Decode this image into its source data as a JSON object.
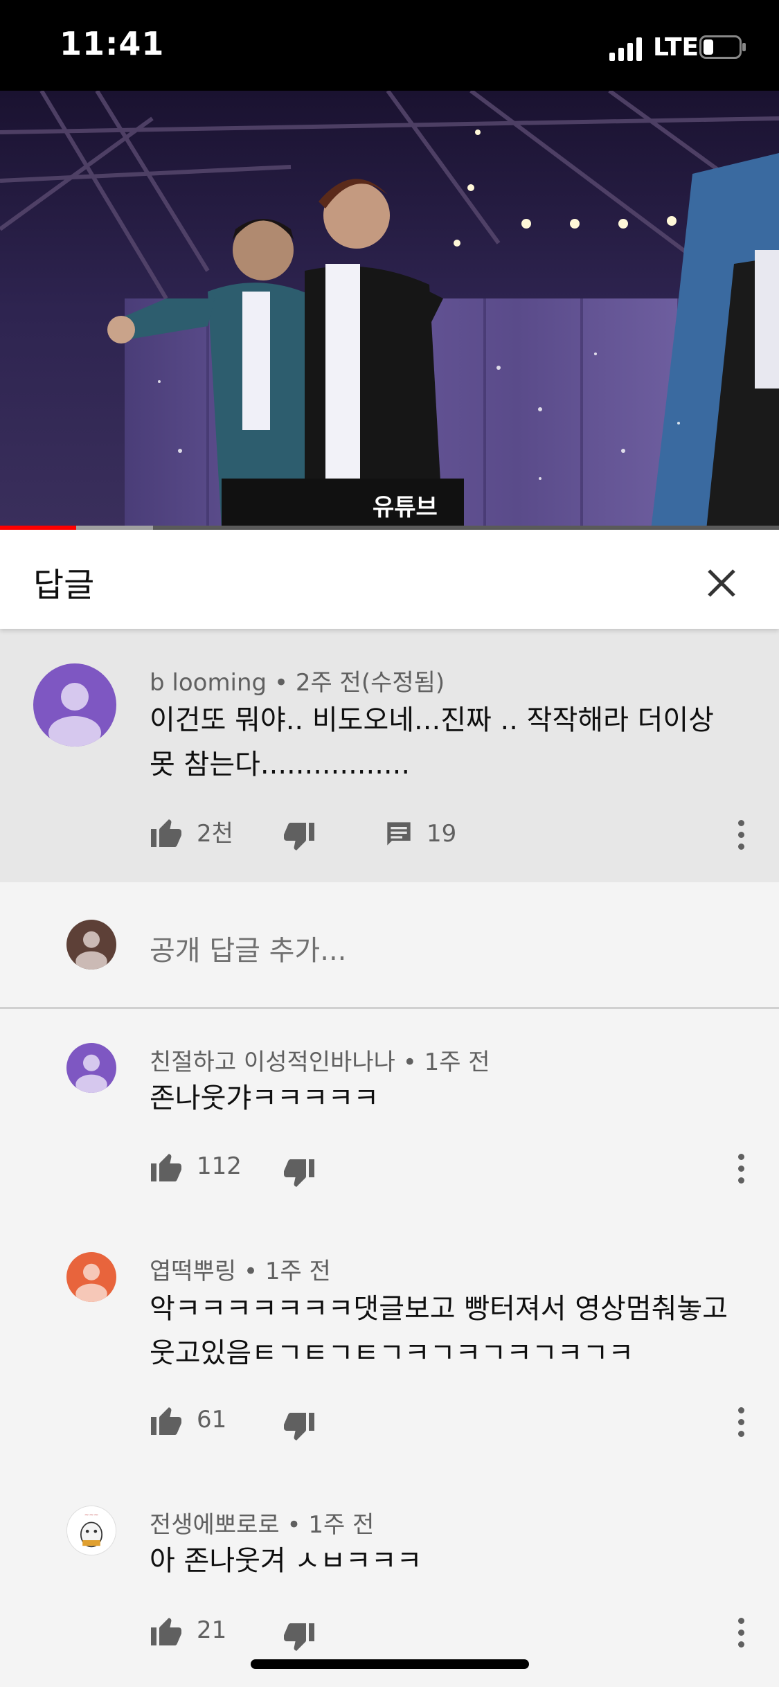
{
  "status_bar": {
    "time": "11:41",
    "network": "LTE"
  },
  "video": {
    "progress_played": 0.098,
    "progress_buffered": 0.196,
    "watermark": "유튜브"
  },
  "header": {
    "title": "답글"
  },
  "parent_comment": {
    "author": "b looming",
    "time": "2주 전(수정됨)",
    "text": "이건또 뭐야.. 비도오네...진짜 .. 작작해라 더이상 못 참는다.................",
    "likes": "2천",
    "replies": "19",
    "avatar_color": "#7e57c2"
  },
  "reply_input": {
    "placeholder": "공개 답글 추가...",
    "avatar_color": "#5d4037"
  },
  "replies": [
    {
      "author": "친절하고 이성적인바나나",
      "time": "1주 전",
      "text": "존나웃갸ㅋㅋㅋㅋㅋ",
      "likes": "112",
      "avatar_color": "#7e57c2"
    },
    {
      "author": "엽떡뿌링",
      "time": "1주 전",
      "text": "악ㅋㅋㅋㅋㅋㅋㅋ댓글보고 빵터져서 영상멈춰놓고 웃고있음ㅌㄱㅌㄱㅌㄱㅋㄱㅋㄱㅋㄱㅋㄱㅋ",
      "likes": "61",
      "avatar_color": "#e8643c"
    },
    {
      "author": "전생에뽀로로",
      "time": "1주 전",
      "text": "아 존나웃겨 ㅅㅂㅋㅋㅋ",
      "likes": "21",
      "avatar_color": "#ffffff"
    }
  ],
  "separator": "•"
}
